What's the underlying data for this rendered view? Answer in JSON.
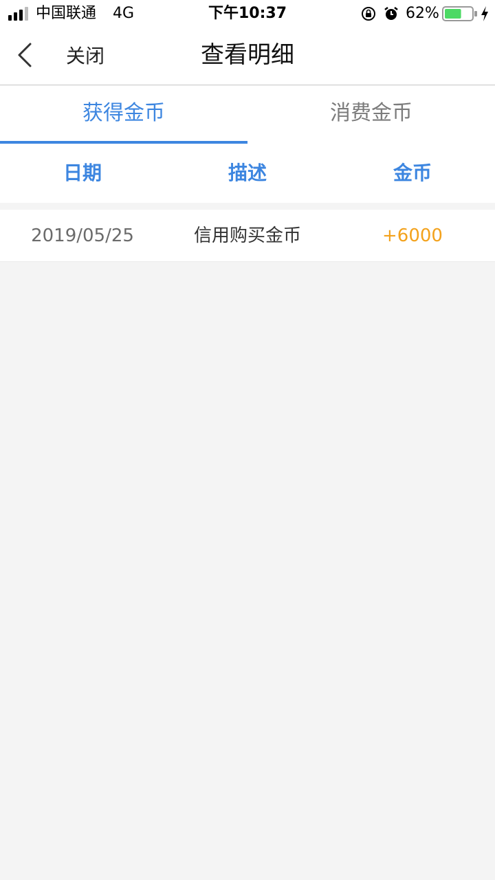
{
  "status_bar": {
    "carrier": "中国联通",
    "network": "4G",
    "time": "下午10:37",
    "battery": "62%",
    "battery_level": 0.62,
    "icons": [
      "signal-icon",
      "rotation-lock-icon",
      "alarm-icon",
      "battery-icon",
      "charging-icon"
    ]
  },
  "nav": {
    "back_icon": "chevron-left-icon",
    "close_label": "关闭",
    "title": "查看明细"
  },
  "tabs": [
    {
      "label": "获得金币",
      "active": true
    },
    {
      "label": "消费金币",
      "active": false
    }
  ],
  "columns": [
    "日期",
    "描述",
    "金币"
  ],
  "rows": [
    {
      "date": "2019/05/25",
      "description": "信用购买金币",
      "amount": "+6000"
    }
  ],
  "colors": {
    "accent": "#3d86e0",
    "amount": "#f3a21c",
    "background": "#f4f4f4"
  }
}
